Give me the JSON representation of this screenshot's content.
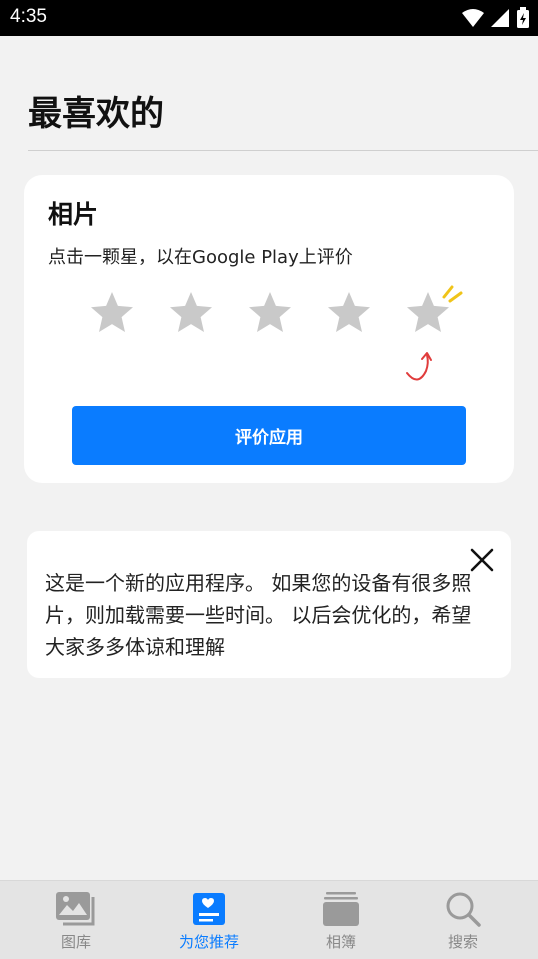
{
  "status_bar": {
    "time": "4:35"
  },
  "page": {
    "title": "最喜欢的"
  },
  "rating_card": {
    "title": "相片",
    "subtitle": "点击一颗星，以在Google Play上评价",
    "star_count": 5,
    "button_label": "评价应用",
    "colors": {
      "star": "#c9c9c9",
      "button": "#0a7cff",
      "arrow": "#e03c3c",
      "sparkle": "#f0c419"
    }
  },
  "notice_card": {
    "text": "这是一个新的应用程序。 如果您的设备有很多照片，则加载需要一些时间。 以后会优化的，希望大家多多体谅和理解"
  },
  "bottom_nav": {
    "items": [
      {
        "label": "图库",
        "icon": "gallery-icon",
        "active": false
      },
      {
        "label": "为您推荐",
        "icon": "recommend-icon",
        "active": true
      },
      {
        "label": "相簿",
        "icon": "album-icon",
        "active": false
      },
      {
        "label": "搜索",
        "icon": "search-icon",
        "active": false
      }
    ],
    "colors": {
      "active": "#0a7cff",
      "inactive": "#9a9a9a"
    }
  }
}
